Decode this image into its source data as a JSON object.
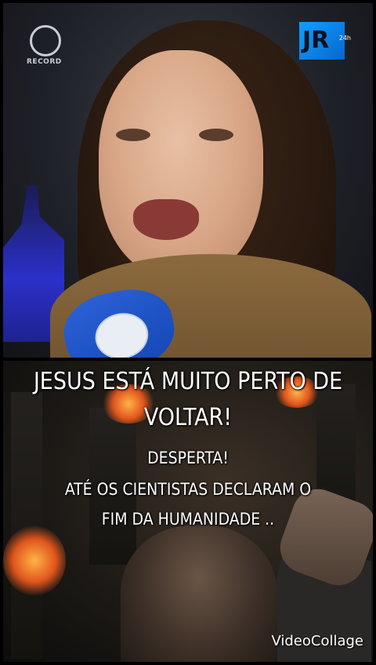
{
  "top_panel": {
    "channel_logo_text": "RECORD",
    "program_logo_text": "JR",
    "program_logo_suffix": "24h"
  },
  "bottom_panel": {
    "title": "JESUS ESTÁ MUITO PERTO DE VOLTAR!",
    "line1": "DESPERTA!",
    "line2": "ATÉ OS CIENTISTAS DECLARAM O",
    "line3": "FIM DA HUMANIDADE ..",
    "watermark": "VideoCollage"
  }
}
